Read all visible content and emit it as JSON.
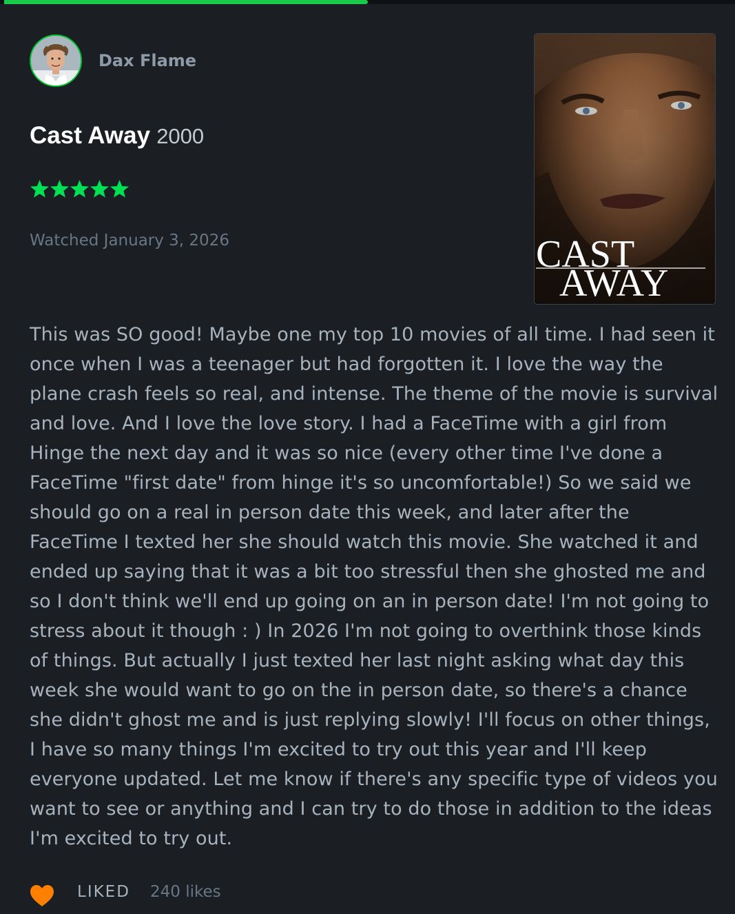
{
  "progress": {
    "fraction": 0.5,
    "color": "#19c94a"
  },
  "review": {
    "author": "Dax Flame",
    "film_title": "Cast Away",
    "film_year": "2000",
    "rating_stars": 5,
    "watched_text": "Watched January 3, 2026",
    "poster_title_line1": "CAST",
    "poster_title_line2": "AWAY",
    "body": "This was SO good! Maybe one my top 10 movies of all time. I had seen it once when I was a teenager but had forgotten it. I love the way the plane crash feels so real, and intense. The theme of the movie is survival and love. And I love the love story. I had a FaceTime with a girl from Hinge the next day and it was so nice (every other time I've done a FaceTime \"first date\" from hinge it's so uncomfortable!) So we said we should go on a real in person date this week, and later after the FaceTime I texted her she should watch this movie. She watched it and ended up saying that it was a bit too stressful then she ghosted me and so I don't think we'll end up going on an in person date! I'm not going to stress about it though : ) In 2026 I'm not going to overthink those kinds of things. But actually I just texted her last night asking what day this week she would want to go on the in person date, so there's a chance she didn't ghost me and is just replying slowly! I'll focus on other things, I have so many things I'm excited to try out this year and I'll keep everyone updated. Let me know if there's any specific type of videos you want to see or anything and I can try to do those in addition to the ideas I'm excited to try out.",
    "liked_label": "LIKED",
    "likes_text": "240 likes"
  },
  "colors": {
    "background": "#1b1e23",
    "star": "#00e054",
    "heart": "#ff8000",
    "avatar_ring": "#00c030"
  },
  "icons": {
    "star": "star-icon",
    "heart": "heart-icon"
  }
}
